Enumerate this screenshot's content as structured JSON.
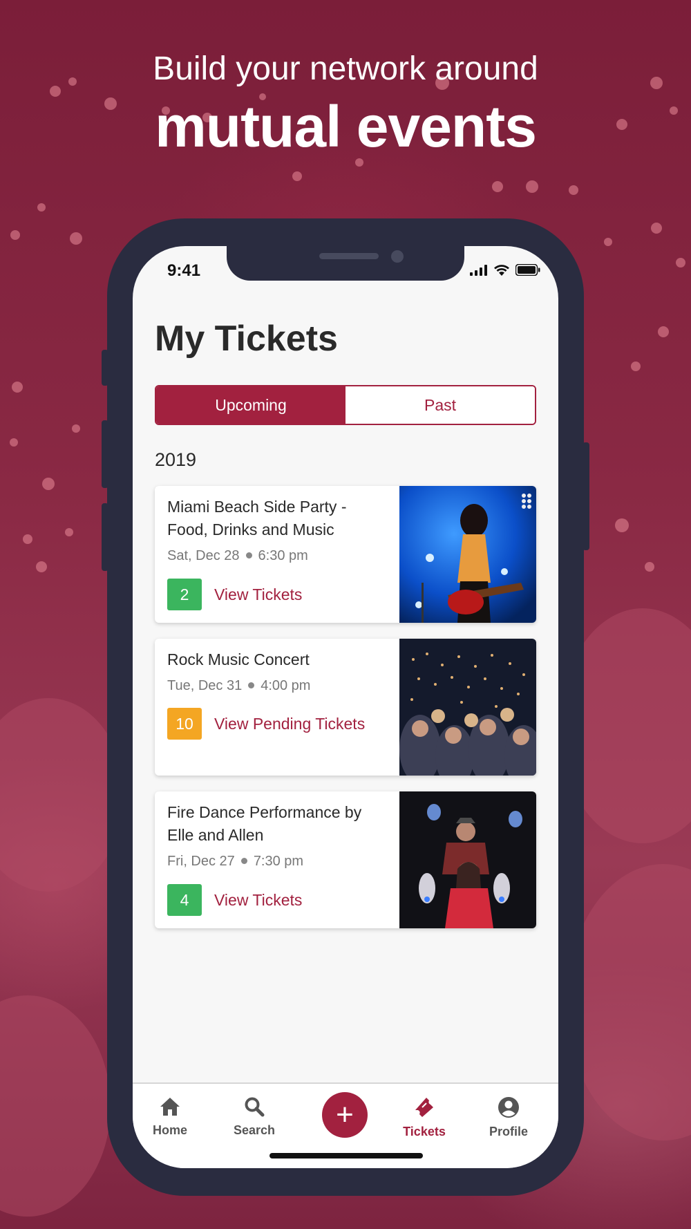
{
  "headline": {
    "line1": "Build your network around",
    "line2": "mutual events"
  },
  "status_bar": {
    "time": "9:41",
    "icons": [
      "cellular-signal-icon",
      "wifi-icon",
      "battery-icon"
    ]
  },
  "page_title": "My Tickets",
  "segments": {
    "upcoming": "Upcoming",
    "past": "Past",
    "selected": "Upcoming"
  },
  "year": "2019",
  "events": [
    {
      "name_line1": "Miami Beach Side Party -",
      "name_line2": "Food, Drinks and Music",
      "day": "Sat, Dec 28",
      "time": "6:30 pm",
      "count": "2",
      "count_color": "#3bb55e",
      "action": "View Tickets",
      "image": "guitarist-on-stage"
    },
    {
      "name_line1": "Rock Music Concert",
      "name_line2": "",
      "day": "Tue, Dec 31",
      "time": "4:00 pm",
      "count": "10",
      "count_color": "#f4a623",
      "action": "View Pending Tickets",
      "image": "concert-crowd"
    },
    {
      "name_line1": "Fire Dance Performance by",
      "name_line2": "Elle and Allen",
      "day": "Fri, Dec 27",
      "time": "7:30 pm",
      "count": "4",
      "count_color": "#3bb55e",
      "action": "View Tickets",
      "image": "fire-dancers"
    }
  ],
  "tab_bar": {
    "home": "Home",
    "search": "Search",
    "add": "+",
    "tickets": "Tickets",
    "profile": "Profile",
    "active": "Tickets"
  },
  "colors": {
    "brand": "#a2213f",
    "background": "#7b1e39"
  }
}
